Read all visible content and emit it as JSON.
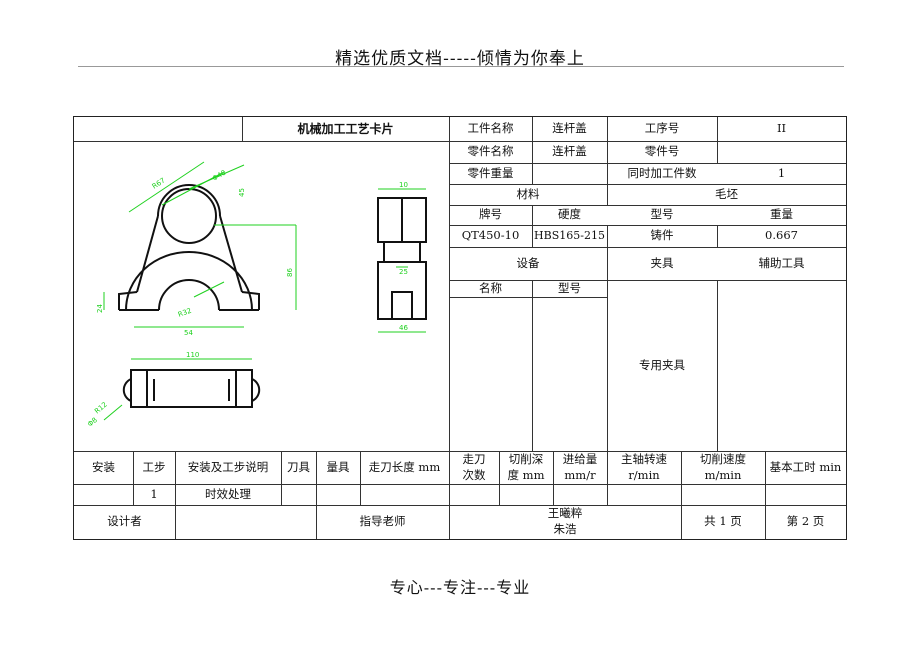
{
  "page": {
    "header": "精选优质文档-----倾情为你奉上",
    "footer": "专心---专注---专业"
  },
  "card": {
    "title": "机械加工工艺卡片",
    "part_name_label": "工件名称",
    "part_name_value": "连杆盖",
    "process_no_label": "工序号",
    "process_no_value": "II",
    "component_name_label": "零件名称",
    "component_name_value": "连杆盖",
    "component_no_label": "零件号",
    "component_no_value": "",
    "component_weight_label": "零件重量",
    "simultaneous_label": "同时加工件数",
    "simultaneous_value": "1",
    "material_label": "材料",
    "blank_label": "毛坯",
    "grade_label": "牌号",
    "hardness_label": "硬度",
    "type_label": "型号",
    "weight_label": "重量",
    "grade_value": "QT450-10",
    "hardness_value": "HBS165-215",
    "type_value": "铸件",
    "weight_value": "0.667",
    "equipment_label": "设备",
    "fixture_label": "夹具",
    "aux_tool_label": "辅助工具",
    "name_label": "名称",
    "model_label": "型号",
    "fixture_value": "专用夹具"
  },
  "process_header": {
    "install": "安装",
    "step": "工步",
    "desc": "安装及工步说明",
    "tool": "刀具",
    "gauge": "量具",
    "feed_len": "走刀长度 mm",
    "passes_1": "走刀",
    "passes_2": "次数",
    "cut_depth_1": "切削深",
    "cut_depth_2": "度 mm",
    "feed_1": "进给量",
    "feed_2": "mm/r",
    "spindle_1": "主轴转速",
    "spindle_2": "r/min",
    "cut_speed_1": "切削速度",
    "cut_speed_2": "m/min",
    "base_time": "基本工时 min"
  },
  "process_rows": [
    {
      "step": "1",
      "desc": "时效处理"
    }
  ],
  "signoff": {
    "designer_label": "设计者",
    "advisor_label": "指导老师",
    "name_1": "王曦粹",
    "name_2": "朱浩",
    "total_pages": "共 1 页",
    "page_no": "第 2 页"
  },
  "drawing": {
    "dims": {
      "d1": "R67",
      "d2": "Φ40",
      "d3": "45",
      "d4": "86",
      "d5": "24",
      "d6": "R32",
      "d7": "54",
      "d8": "110",
      "d9": "R12",
      "d10": "Φ8",
      "d11": "10",
      "d12": "25",
      "d13": "46"
    },
    "colors": {
      "line": "#111111",
      "dimension": "#1fd11f"
    }
  }
}
